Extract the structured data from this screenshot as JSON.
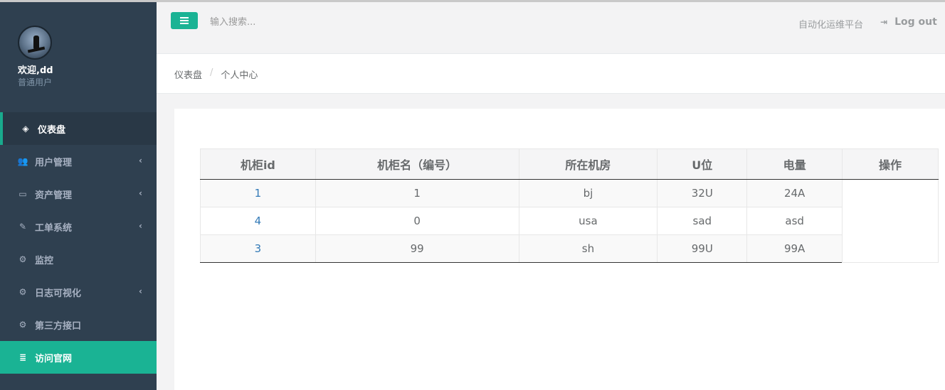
{
  "sidebar": {
    "welcome": "欢迎,dd",
    "role": "普通用户",
    "items": [
      {
        "label": "仪表盘",
        "icon": "gitlab-icon",
        "glyph": "◈",
        "state": "active",
        "chevron": false
      },
      {
        "label": "用户管理",
        "icon": "users-icon",
        "glyph": "👥",
        "state": "",
        "chevron": true
      },
      {
        "label": "资产管理",
        "icon": "hdd-icon",
        "glyph": "▭",
        "state": "",
        "chevron": true
      },
      {
        "label": "工单系统",
        "icon": "edit-icon",
        "glyph": "✎",
        "state": "",
        "chevron": true
      },
      {
        "label": "监控",
        "icon": "cogs-icon",
        "glyph": "⚙",
        "state": "",
        "chevron": false
      },
      {
        "label": "日志可视化",
        "icon": "cogs-icon",
        "glyph": "⚙",
        "state": "",
        "chevron": true
      },
      {
        "label": "第三方接口",
        "icon": "cogs-icon",
        "glyph": "⚙",
        "state": "",
        "chevron": false
      },
      {
        "label": "访问官网",
        "icon": "database-icon",
        "glyph": "≣",
        "state": "highlight",
        "chevron": false
      }
    ]
  },
  "header": {
    "search_placeholder": "输入搜索...",
    "platform": "自动化运维平台",
    "logout": "Log out"
  },
  "breadcrumb": [
    "仪表盘",
    "个人中心"
  ],
  "table": {
    "columns": [
      "机柜id",
      "机柜名（编号）",
      "所在机房",
      "U位",
      "电量",
      "操作"
    ],
    "rows": [
      [
        "1",
        "1",
        "bj",
        "32U",
        "24A"
      ],
      [
        "4",
        "0",
        "usa",
        "sad",
        "asd"
      ],
      [
        "3",
        "99",
        "sh",
        "99U",
        "99A"
      ]
    ]
  },
  "colors": {
    "sidebar_bg": "#2f4050",
    "accent": "#1ab394",
    "link": "#337ab7"
  }
}
